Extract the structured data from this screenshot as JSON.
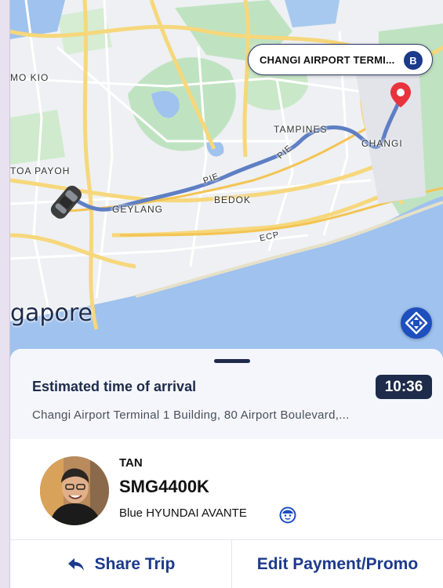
{
  "map": {
    "labels": {
      "ang_mo_kio": "MO KIO",
      "toa_payoh": "TOA PAYOH",
      "geylang": "GEYLANG",
      "bedok": "BEDOK",
      "tampines": "TAMPINES",
      "changi": "CHANGI",
      "pie_1": "PIE",
      "pie_2": "PIE",
      "ecp": "ECP",
      "city": "gapore"
    },
    "destination": {
      "label": "CHANGI AIRPORT TERMI...",
      "badge": "B"
    },
    "colors": {
      "route": "#5f7fc4",
      "water": "#9fc2ee",
      "park": "#bfe3c1",
      "road": "#f6d77b",
      "pin": "#e8323c"
    },
    "icons": {
      "car": "car-icon",
      "pin": "destination-pin-icon",
      "recenter": "recenter-icon"
    }
  },
  "eta": {
    "title": "Estimated time of arrival",
    "time": "10:36",
    "address": "Changi Airport Terminal 1 Building, 80 Airport Boulevard,..."
  },
  "driver": {
    "name": "TAN",
    "plate": "SMG4400K",
    "vehicle": "Blue HYUNDAI AVANTE",
    "vehicle_icon": "driver-face-icon"
  },
  "actions": {
    "share": "Share Trip",
    "share_icon": "share-arrow-icon",
    "edit": "Edit Payment/Promo"
  },
  "theme": {
    "primary": "#1c3a8c",
    "dark": "#1e2b4a"
  }
}
